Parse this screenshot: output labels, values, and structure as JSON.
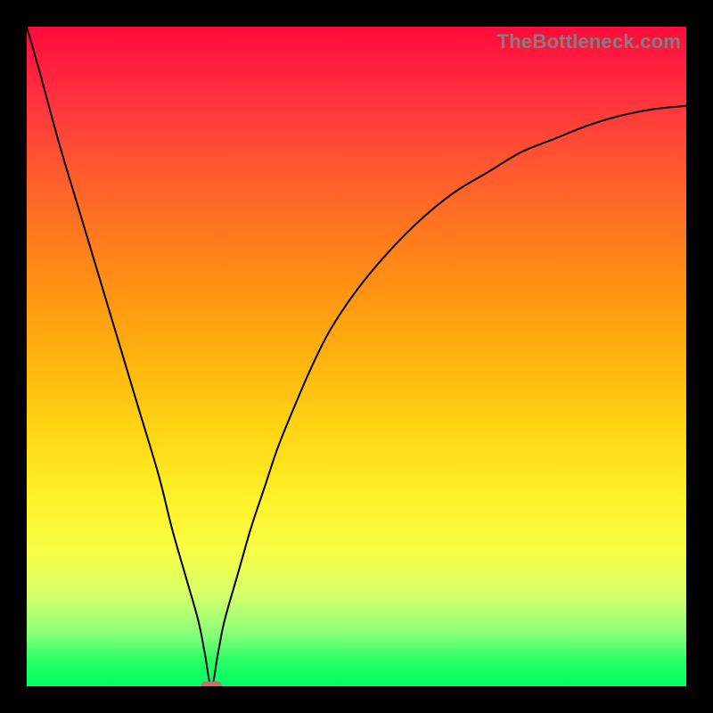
{
  "watermark": "TheBottleneck.com",
  "chart_data": {
    "type": "line",
    "title": "",
    "xlabel": "",
    "ylabel": "",
    "xlim": [
      0,
      100
    ],
    "ylim": [
      0,
      100
    ],
    "grid": false,
    "marker": {
      "x": 28,
      "y": 0
    },
    "series": [
      {
        "name": "curve",
        "x": [
          0,
          2,
          5,
          8,
          11,
          14,
          17,
          20,
          22,
          24,
          26,
          27,
          28,
          29,
          30,
          32,
          34,
          36,
          38,
          40,
          43,
          46,
          50,
          55,
          60,
          65,
          70,
          75,
          80,
          85,
          90,
          95,
          100
        ],
        "y": [
          100,
          93,
          82,
          72,
          62,
          52,
          42,
          32,
          24,
          17,
          10,
          5,
          0,
          5,
          10,
          17,
          24,
          30,
          36,
          41,
          48,
          54,
          60,
          66,
          71,
          75,
          78,
          81,
          83,
          85,
          86.5,
          87.5,
          88
        ]
      }
    ]
  }
}
